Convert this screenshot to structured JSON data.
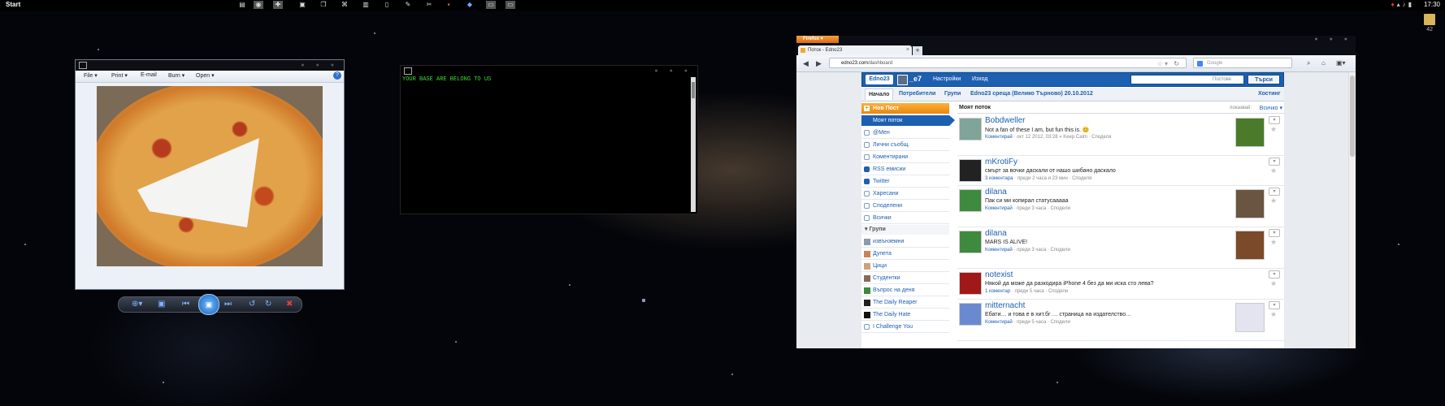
{
  "taskbar": {
    "start_label": "Start",
    "clock": "17:30",
    "tray_icons": [
      "antivirus-icon",
      "network-icon",
      "volume-icon",
      "battery-icon"
    ],
    "icons": [
      "files-icon",
      "system-icon",
      "plug-icon",
      "windows-icon",
      "copy-icon",
      "network-icon",
      "chart-icon",
      "document-icon",
      "wrench-icon",
      "tools-icon",
      "save-icon",
      "cube-icon",
      "window-icon",
      "window-icon"
    ]
  },
  "desktop": {
    "folder_label": "42"
  },
  "photo_viewer": {
    "menu": [
      "File ▾",
      "Print ▾",
      "E-mail",
      "Burn ▾",
      "Open ▾"
    ],
    "help": "?",
    "controls": [
      "zoom-icon",
      "fit-icon",
      "previous-icon",
      "slideshow-icon",
      "next-icon",
      "rotate-left-icon",
      "rotate-right-icon",
      "delete-icon"
    ]
  },
  "terminal": {
    "text": "YOUR BASE ARE BELONG TO US"
  },
  "firefox": {
    "menu_button": "Firefox ▾",
    "tab_title": "Поток - Edno23",
    "tab_close": "×",
    "new_tab": "+",
    "url_host": "edno23.com",
    "url_path": "/dashboard",
    "search_placeholder": "Google",
    "site": {
      "logo": "Edno23",
      "username": "_e7",
      "settings": "Настройки",
      "logout": "Изход",
      "search_placeholder": "Постове",
      "search_button": "Търси",
      "tabs": [
        "Начало",
        "Потребители",
        "Групи",
        "Edno23 среща (Велико Търново) 20.10.2012",
        "Хостинг"
      ],
      "new_post": "Нов Пост",
      "my_stream": "Моят поток",
      "nav": [
        "@Мен",
        "Лични съобщ.",
        "Коментирани",
        "RSS емисии",
        "Twitter",
        "Харесани",
        "Споделени",
        "Всички"
      ],
      "groups_header": "▾ Групи",
      "groups": [
        "извънземни",
        "Дупета",
        "Цици",
        "Студентки",
        "Въпрос на деня",
        "The Daily Reaper",
        "The Daily Hate",
        "I Challenge You"
      ],
      "feed_title": "Моят поток",
      "feed_filter_label": "показвай:",
      "feed_filter": "Всичко ▾",
      "posts": [
        {
          "author": "Bobdweller",
          "text": "Not a fan of these I am, but fun this is. 😊",
          "meta_link": "Коментирай",
          "meta_rest": " · окт 12 2012, 03:28 » Keep Calm · Споделя"
        },
        {
          "author": "mKrotiFy",
          "text": "смърт за вочки даскали от нашо шибано даскало",
          "meta_link": "3 коментара",
          "meta_rest": " · преди 2 часа и 23 мин · Споделя"
        },
        {
          "author": "dilana",
          "text": "Пак си ми копирал статусааааа",
          "meta_link": "Коментирай",
          "meta_rest": " · преди 3 часа · Сподели"
        },
        {
          "author": "dilana",
          "text": "MARS IS ALIVE!",
          "meta_link": "Коментирай",
          "meta_rest": " · преди 3 часа · Сподели"
        },
        {
          "author": "notexist",
          "text": "Някой да може да разкодира iPhone 4 без да ми иска сто лева?",
          "meta_link": "1 коментар",
          "meta_rest": " · преди 5 часа · Сподели"
        },
        {
          "author": "mitternacht",
          "text": "Ебати… и това е в хит.бг … страница на издателство…",
          "meta_link": "Коментирай",
          "meta_rest": " · преди 5 часа · Сподели"
        }
      ]
    }
  }
}
